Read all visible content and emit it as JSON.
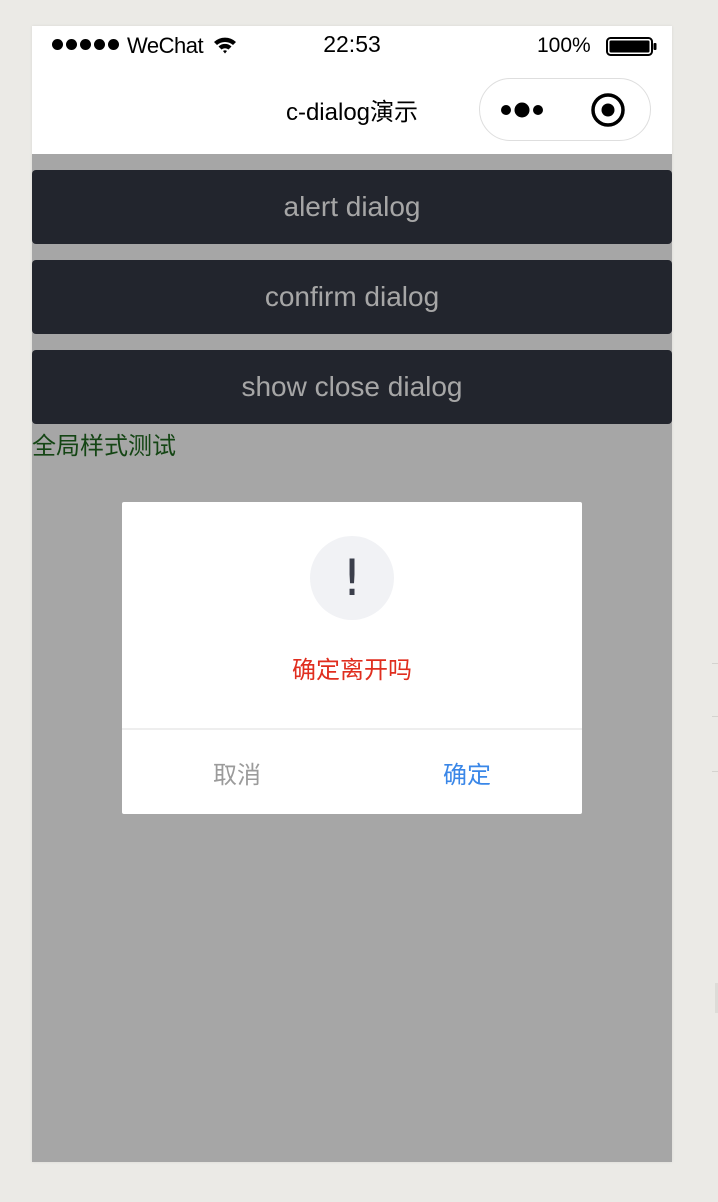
{
  "status_bar": {
    "carrier": "WeChat",
    "time": "22:53",
    "battery": "100%"
  },
  "nav": {
    "title": "c-dialog演示"
  },
  "buttons": {
    "alert": "alert dialog",
    "confirm": "confirm dialog",
    "show_close": "show close dialog"
  },
  "global_style_text": "全局样式测试",
  "dialog": {
    "icon_symbol": "!",
    "message": "确定离开吗",
    "cancel_label": "取消",
    "confirm_label": "确定"
  },
  "colors": {
    "button_bg": "#353945",
    "message_text": "#e02e1f",
    "confirm_text": "#3a87e8",
    "cancel_text": "#9b9b9b",
    "global_text": "#1f6b1f"
  }
}
